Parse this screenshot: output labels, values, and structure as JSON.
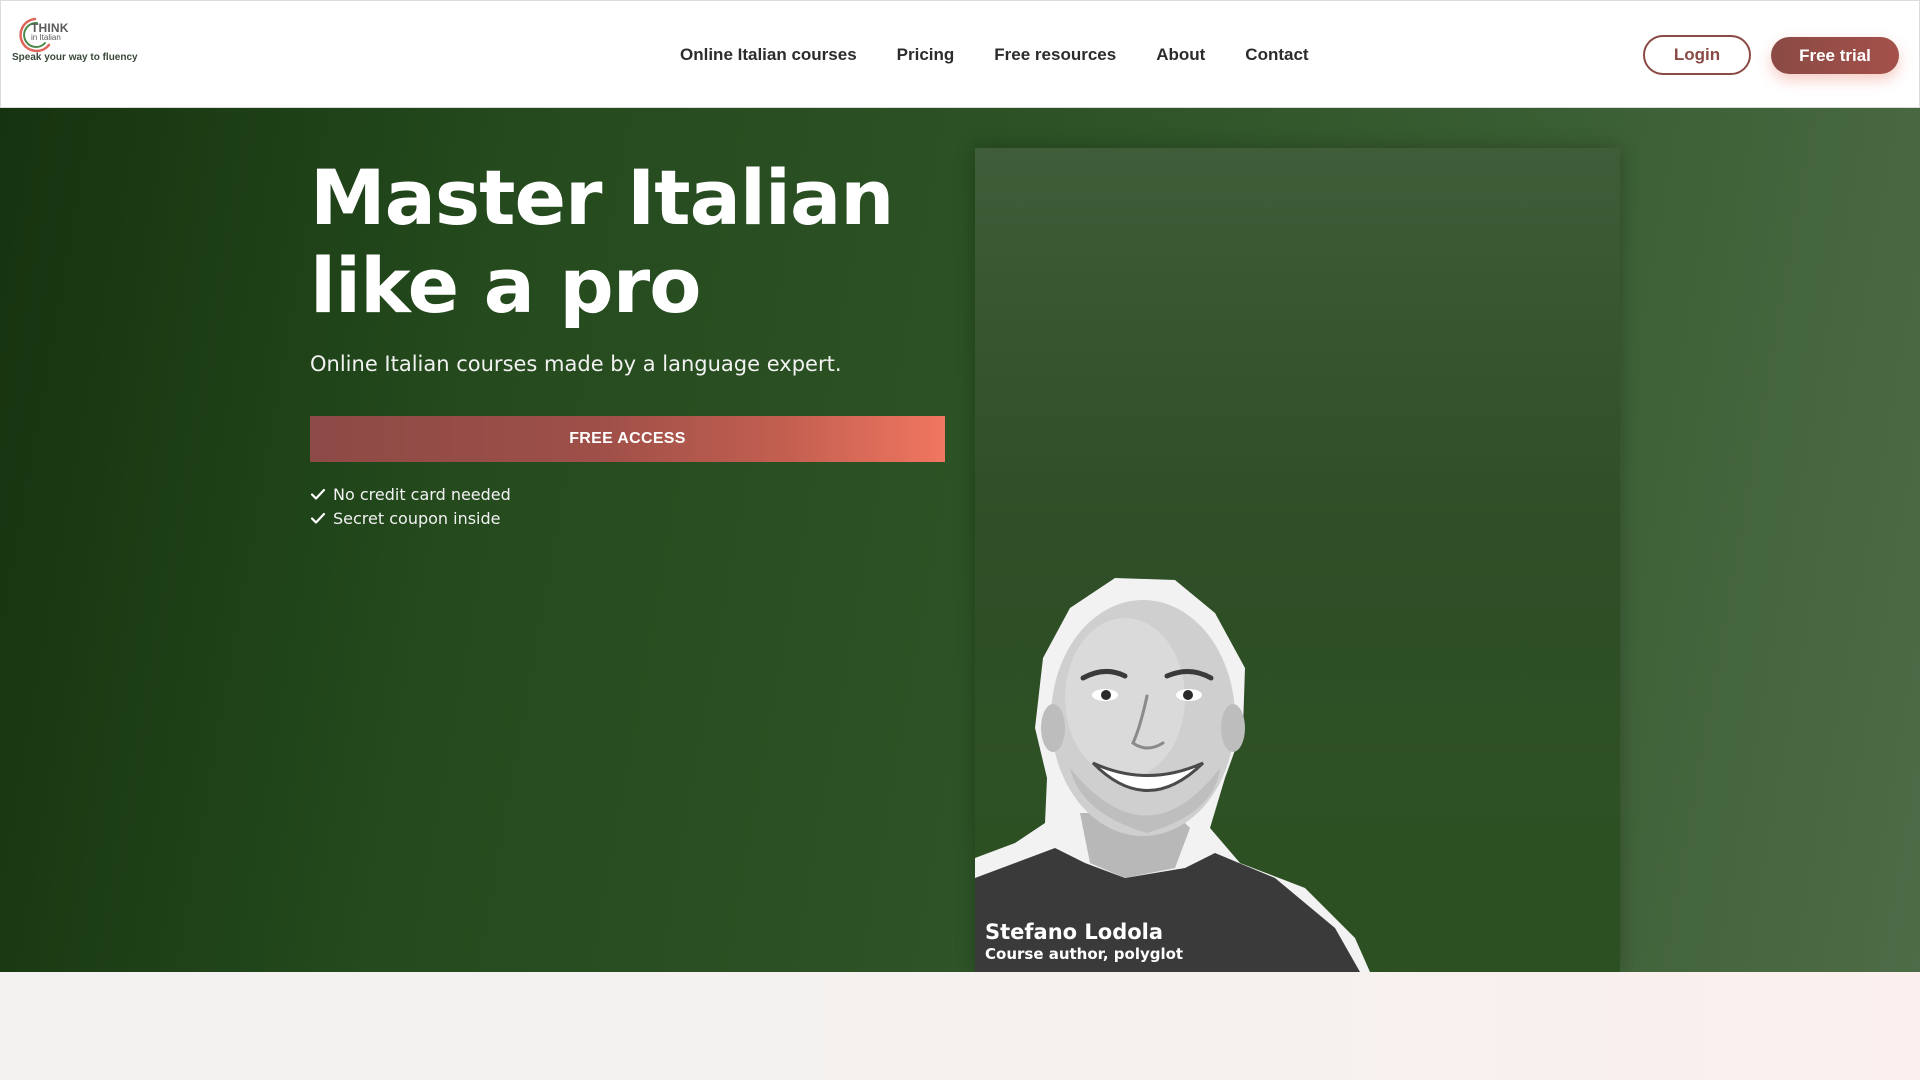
{
  "brand": {
    "name_top": "THINK",
    "name_bottom": "in Italian",
    "tagline": "Speak your way to fluency"
  },
  "nav": {
    "items": [
      {
        "label": "Online Italian courses"
      },
      {
        "label": "Pricing"
      },
      {
        "label": "Free resources"
      },
      {
        "label": "About"
      },
      {
        "label": "Contact"
      }
    ]
  },
  "header": {
    "login_label": "Login",
    "trial_label": "Free trial"
  },
  "hero": {
    "title": "Master Italian like a pro",
    "subtitle": "Online Italian courses made by a language expert.",
    "cta_label": "FREE ACCESS",
    "perks": [
      {
        "label": "No credit card needed",
        "icon": "check-icon"
      },
      {
        "label": "Secret coupon inside",
        "icon": "check-icon"
      }
    ]
  },
  "instructor": {
    "name": "Stefano Lodola",
    "role": "Course author, polyglot"
  },
  "colors": {
    "hero_dark_green": "#16330f",
    "hero_light_green": "#4d6c47",
    "accent_brown": "#8a4a45",
    "accent_coral": "#f07660"
  }
}
